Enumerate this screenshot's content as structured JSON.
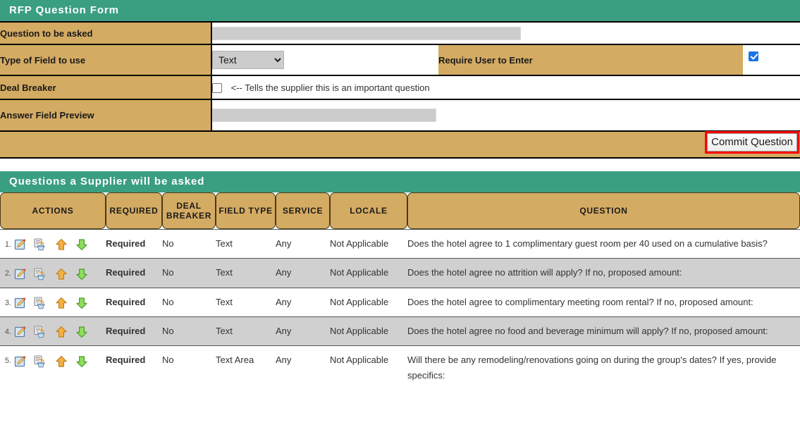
{
  "form": {
    "title": "RFP Question Form",
    "rows": {
      "question_label": "Question to be asked",
      "question_value": "",
      "field_type_label": "Type of Field to use",
      "field_type_value": "Text",
      "field_type_options": [
        "Text"
      ],
      "require_user_label": "Require User to Enter",
      "require_user_checked": true,
      "deal_breaker_label": "Deal Breaker",
      "deal_breaker_checked": false,
      "deal_breaker_hint": "<-- Tells the supplier this is an important question",
      "answer_preview_label": "Answer Field Preview",
      "answer_preview_value": ""
    },
    "commit_button": "Commit Question"
  },
  "questions_panel": {
    "title": "Questions a Supplier will be asked",
    "columns": [
      "ACTIONS",
      "REQUIRED",
      "DEAL BREAKER",
      "FIELD TYPE",
      "SERVICE",
      "LOCALE",
      "QUESTION"
    ],
    "action_icons": [
      "edit-icon",
      "delete-icon",
      "move-up-icon",
      "move-down-icon"
    ],
    "rows": [
      {
        "num": "1.",
        "required": "Required",
        "deal_breaker": "No",
        "field_type": "Text",
        "service": "Any",
        "locale": "Not Applicable",
        "question": "Does the hotel agree to 1 complimentary guest room per 40 used on a cumulative basis?"
      },
      {
        "num": "2.",
        "required": "Required",
        "deal_breaker": "No",
        "field_type": "Text",
        "service": "Any",
        "locale": "Not Applicable",
        "question": "Does the hotel agree no attrition will apply? If no, proposed amount:"
      },
      {
        "num": "3.",
        "required": "Required",
        "deal_breaker": "No",
        "field_type": "Text",
        "service": "Any",
        "locale": "Not Applicable",
        "question": "Does the hotel agree to complimentary meeting room rental? If no, proposed amount:"
      },
      {
        "num": "4.",
        "required": "Required",
        "deal_breaker": "No",
        "field_type": "Text",
        "service": "Any",
        "locale": "Not Applicable",
        "question": "Does the hotel agree no food and beverage minimum will apply? If no, proposed amount:"
      },
      {
        "num": "5.",
        "required": "Required",
        "deal_breaker": "No",
        "field_type": "Text Area",
        "service": "Any",
        "locale": "Not Applicable",
        "question": "Will there be any remodeling/renovations going on during the group's dates? If yes, provide specifics:"
      }
    ]
  },
  "colors": {
    "header_teal": "#3a9e81",
    "label_tan": "#d4ab63",
    "alt_row_gray": "#d0d0d0",
    "highlight_red": "#ff0000",
    "checkbox_blue": "#1a73e8"
  }
}
